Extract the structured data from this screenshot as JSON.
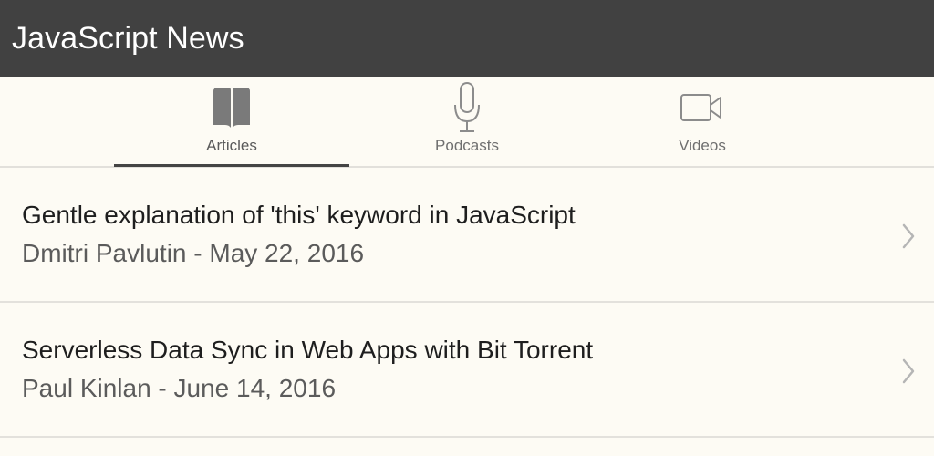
{
  "app": {
    "title": "JavaScript News"
  },
  "tabs": [
    {
      "label": "Articles",
      "icon": "book-icon",
      "active": true
    },
    {
      "label": "Podcasts",
      "icon": "microphone-icon",
      "active": false
    },
    {
      "label": "Videos",
      "icon": "video-camera-icon",
      "active": false
    }
  ],
  "articles": [
    {
      "title": "Gentle explanation of 'this' keyword in JavaScript",
      "meta": "Dmitri Pavlutin - May 22, 2016"
    },
    {
      "title": "Serverless Data Sync in Web Apps with Bit Torrent",
      "meta": "Paul Kinlan - June 14, 2016"
    }
  ],
  "colors": {
    "titlebar_bg": "#414141",
    "page_bg": "#fdfbf4",
    "active_indicator": "#444444",
    "icon_active": "#7a7a7a",
    "icon_inactive": "#8c8c8c"
  }
}
